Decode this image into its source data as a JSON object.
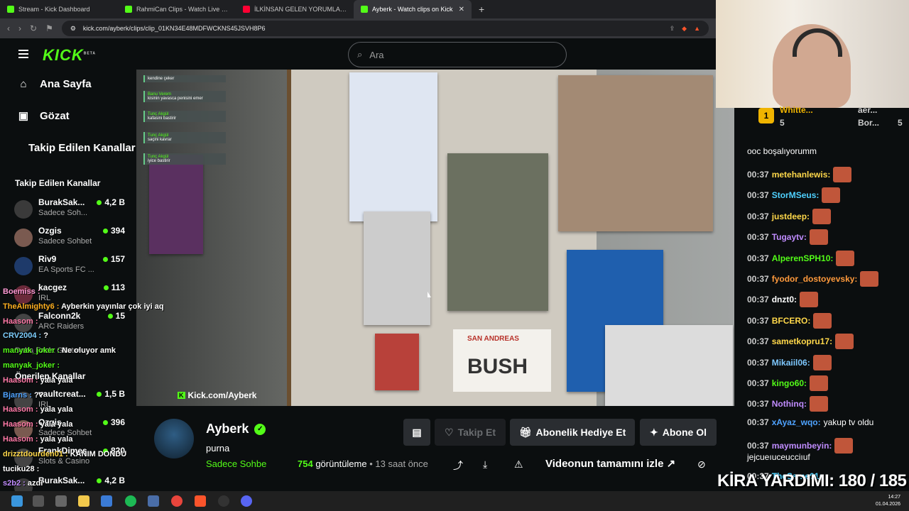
{
  "browser": {
    "tabs": [
      {
        "label": "Stream - Kick Dashboard",
        "icon": "kick-icon"
      },
      {
        "label": "RahmiCan Clips - Watch Live on Kick",
        "icon": "kick-icon"
      },
      {
        "label": "İLKİNSAN GELEN YORUMLARA VE CA",
        "icon": "youtube-icon"
      },
      {
        "label": "Ayberk - Watch clips on Kick",
        "icon": "kick-icon"
      }
    ],
    "url": "kick.com/ayberk/clips/clip_01KN34E48MDFWCKNS45JSVH8P6"
  },
  "header": {
    "logo": "KICK",
    "logo_badge": "BETA",
    "search_placeholder": "Ara"
  },
  "sidebar": {
    "nav": [
      {
        "label": "Ana Sayfa",
        "icon": "home-icon"
      },
      {
        "label": "Gözat",
        "icon": "browse-icon"
      }
    ],
    "followed_heading_top": "Takip Edilen Kanallar",
    "followed_heading": "Takip Edilen Kanallar",
    "followed": [
      {
        "name": "BurakSak...",
        "sub": "Sadece Soh...",
        "count": "4,2 B"
      },
      {
        "name": "Ozgis",
        "sub": "Sadece Sohbet",
        "count": "394"
      },
      {
        "name": "Riv9",
        "sub": "EA Sports FC ...",
        "count": "157"
      },
      {
        "name": "kacgez",
        "sub": "IRL",
        "count": "113"
      },
      {
        "name": "Falconn2k",
        "sub": "ARC Raiders",
        "count": "15"
      }
    ],
    "more": "Daha Fazla Göster",
    "recommended_heading": "Önerilen Kanallar",
    "recommended": [
      {
        "name": "vaultcreat...",
        "sub": "IRL",
        "count": "1,5 B"
      },
      {
        "name": "Ozgis",
        "sub": "Sadece Sohbet",
        "count": "396"
      },
      {
        "name": "FrankDimes",
        "sub": "Slots & Casino",
        "count": "820"
      },
      {
        "name": "BurakSak...",
        "sub": "",
        "count": "4,2 B"
      }
    ]
  },
  "video": {
    "watermark": "Kick.com/Ayberk",
    "overlay_msgs": [
      {
        "user": "",
        "text": "kendine çeker"
      },
      {
        "user": "Banu Verem",
        "text": "kisinin yavasca penisini emer"
      },
      {
        "user": "Tunç Akgül",
        "text": "kafasini bastirir"
      },
      {
        "user": "Tunç Akgül",
        "text": "saçini kavrar"
      },
      {
        "user": "Tunç Akgül",
        "text": "iyice bastirir"
      }
    ],
    "sign": "BUSH",
    "sign_top": "SAN ANDREAS"
  },
  "clip_info": {
    "streamer": "Ayberk",
    "title": "purna",
    "category": "Sadece Sohbe",
    "views_count": "754",
    "views_word": "görüntüleme",
    "time_ago": "13 saat önce",
    "follow_label": "Takip Et",
    "gift_label": "Abonelik Hediye Et",
    "sub_label": "Abone Ol",
    "watch_full": "Videonun tamamını izle"
  },
  "chat": {
    "top": [
      {
        "name": "Whitte...",
        "count": "5"
      },
      {
        "name": "aer...",
        "count": "5"
      },
      {
        "name": "Bor...",
        "count": "5"
      }
    ],
    "first_line": "ooc boşalıyorumm",
    "messages": [
      {
        "time": "00:37",
        "user": "metehanlewis:",
        "color": "#ffd84a",
        "text": ""
      },
      {
        "time": "00:37",
        "user": "StorMSeus:",
        "color": "#4fd1ff",
        "text": ""
      },
      {
        "time": "00:37",
        "user": "justdeep:",
        "color": "#ffd84a",
        "text": ""
      },
      {
        "time": "00:37",
        "user": "Tugaytv:",
        "color": "#c08cff",
        "text": ""
      },
      {
        "time": "00:37",
        "user": "AlperenSPH10:",
        "color": "#53fc18",
        "text": ""
      },
      {
        "time": "00:37",
        "user": "fyodor_dostoyevsky:",
        "color": "#ff9a3c",
        "text": ""
      },
      {
        "time": "00:37",
        "user": "dnzt0:",
        "color": "#ffffff",
        "text": ""
      },
      {
        "time": "00:37",
        "user": "BFCERO:",
        "color": "#ffd84a",
        "text": ""
      },
      {
        "time": "00:37",
        "user": "sametkopru17:",
        "color": "#ffd84a",
        "text": ""
      },
      {
        "time": "00:37",
        "user": "Mikaiil06:",
        "color": "#7ec8ff",
        "text": ""
      },
      {
        "time": "00:37",
        "user": "kingo60:",
        "color": "#53fc18",
        "text": ""
      },
      {
        "time": "00:37",
        "user": "Nothinq:",
        "color": "#c08cff",
        "text": ""
      },
      {
        "time": "00:37",
        "user": "xAyaz_wqo:",
        "color": "#4fa3ff",
        "text": "yakup tv oldu"
      },
      {
        "time": "00:37",
        "user": "maymunbeyin:",
        "color": "#c08cff",
        "text": ""
      }
    ],
    "wrap_line": "jejcueıuceucciıuf",
    "last_time": "00:37",
    "last_user": "TheSame01:"
  },
  "overlay_chat": [
    {
      "user": "Boemiss :",
      "text": "",
      "color": "#ff9ad5"
    },
    {
      "user": "TheAlmighty6 :",
      "text": "Ayberkin yayınlar çok iyi aq",
      "color": "#ffb020"
    },
    {
      "user": "Haasom :",
      "text": "",
      "color": "#ff7aa8"
    },
    {
      "user": "CRV2004 :",
      "text": "?",
      "color": "#7fd0ff"
    },
    {
      "user": "manyak_joker :",
      "text": "Ne oluyor amk",
      "color": "#53fc18"
    },
    {
      "user": "manyak_joker :",
      "text": "",
      "color": "#53fc18"
    },
    {
      "user": "Haasom :",
      "text": "yala yala",
      "color": "#ff7aa8"
    },
    {
      "user": "Bjarns :",
      "text": "??",
      "color": "#4fa3ff"
    },
    {
      "user": "Haasom :",
      "text": "yala yala",
      "color": "#ff7aa8"
    },
    {
      "user": "Haasom :",
      "text": "yala yala",
      "color": "#ff7aa8"
    },
    {
      "user": "Haasom :",
      "text": "yala yala",
      "color": "#ff7aa8"
    },
    {
      "user": "drizztdourden01 :",
      "text": "KANIM DONDU",
      "color": "#ffd84a"
    },
    {
      "user": "tuciku28 :",
      "text": "",
      "color": "#ffffff"
    },
    {
      "user": "s2b2 :",
      "text": "azdı",
      "color": "#c08cff"
    },
    {
      "user": "s2b2 :",
      "text": "azdı",
      "color": "#c08cff"
    }
  ],
  "kira": "KİRA YARDIMI: 180 / 185",
  "clock": {
    "time": "14:27",
    "date": "01.04.2026"
  }
}
